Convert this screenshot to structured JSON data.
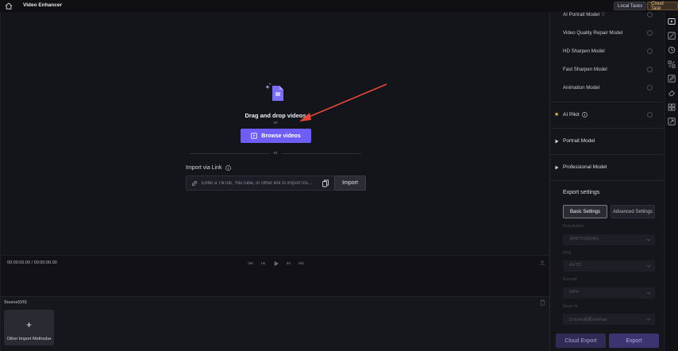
{
  "topbar": {
    "title": "Video Enhancer",
    "local_tasks": "Local Tasks",
    "cloud_task": "Cloud Task"
  },
  "drop": {
    "headline": "Drag and drop videos",
    "or_small": "or",
    "browse_label": "Browse videos",
    "or_divider": "or"
  },
  "link_import": {
    "label": "Import via Link",
    "placeholder": "Enter a TikTok, YouTube, or other link to import ins...",
    "import_label": "Import"
  },
  "timeline": {
    "time": "00:00:00.00 / 00:00:00.00"
  },
  "source": {
    "title": "Source(0/0)",
    "other_import": "Other Import Methods"
  },
  "models": {
    "items": [
      {
        "label": "AI Portrait Model"
      },
      {
        "label": "Video Quality Repair Model"
      },
      {
        "label": "HD Sharpen Model"
      },
      {
        "label": "Fast Sharpen Model"
      },
      {
        "label": "Animation Model"
      }
    ],
    "ai_pilot": "AI Pilot",
    "portrait_model": "Portrait Model",
    "professional_model": "Professional Model"
  },
  "export": {
    "title": "Export settings",
    "basic": "Basic Settings",
    "advanced": "Advanced Settings",
    "fields": [
      {
        "label": "Resolution",
        "value": "3840*2160(4K)"
      },
      {
        "label": "FPS",
        "value": "AUTO"
      },
      {
        "label": "Format",
        "value": "MP4"
      },
      {
        "label": "Save to",
        "value": "D:\\tom\\桌面\\HitPaw"
      }
    ],
    "cloud_export": "Cloud Export",
    "export": "Export"
  },
  "colors": {
    "accent": "#6e5ef5",
    "annotation_arrow": "#e5483a"
  }
}
